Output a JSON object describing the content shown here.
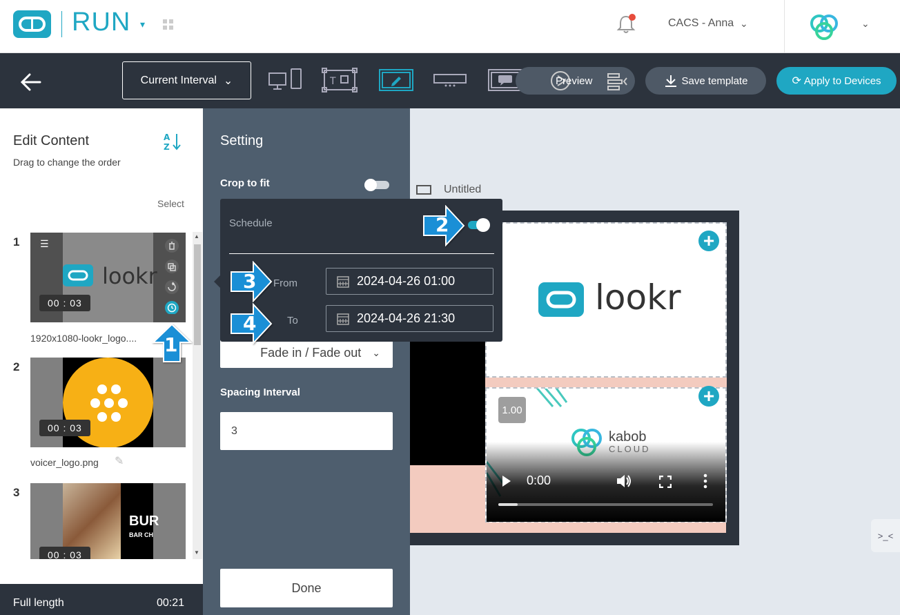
{
  "header": {
    "app_name": "RUN",
    "user_label": "CACS - Anna"
  },
  "toolbar": {
    "interval_label": "Current Interval",
    "preview_label": "Preview",
    "save_label": "Save template",
    "apply_label": "Apply to Devices"
  },
  "edit_content": {
    "title": "Edit Content",
    "subtitle": "Drag to change the order",
    "select_label": "Select",
    "items": [
      {
        "index": "1",
        "duration": "00 : 03",
        "filename": "1920x1080-lookr_logo...."
      },
      {
        "index": "2",
        "duration": "00 : 03",
        "filename": "voicer_logo.png"
      },
      {
        "index": "3",
        "duration": "00 : 03",
        "filename": ""
      }
    ],
    "footer_label": "Full length",
    "footer_value": "00:21"
  },
  "setting": {
    "title": "Setting",
    "crop_label": "Crop to fit",
    "transition_value": "Fade in / Fade out",
    "spacing_label": "Spacing Interval",
    "spacing_value": "3",
    "done_label": "Done"
  },
  "schedule_popup": {
    "label": "Schedule",
    "from_label": "From",
    "from_value": "2024-04-26 01:00",
    "to_label": "To",
    "to_value": "2024-04-26 21:30"
  },
  "canvas": {
    "title": "Untitled",
    "lookr_text": "lookr",
    "speed_value": "1.00",
    "kabob_line1": "kabob",
    "kabob_line2": "CLOUD",
    "video_time": "0:00",
    "thumb_burger_text": "BUR",
    "thumb_burger_sub": "BAR CH"
  },
  "callouts": [
    "1",
    "2",
    "3",
    "4"
  ],
  "colors": {
    "accent": "#1fa7c3",
    "toolbar_bg": "#2c333d",
    "setting_bg": "#4e5e6e",
    "callout_blue": "#1a8fd6",
    "notify_dot": "#e74c3c"
  }
}
